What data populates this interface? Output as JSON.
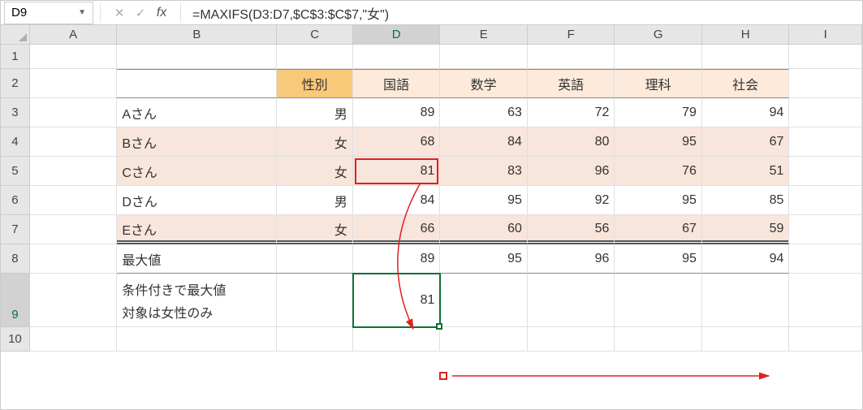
{
  "nameBox": "D9",
  "formula": "=MAXIFS(D3:D7,$C$3:$C$7,\"女\")",
  "fxLabel": "fx",
  "columns": [
    "A",
    "B",
    "C",
    "D",
    "E",
    "F",
    "G",
    "H",
    "I"
  ],
  "rowNumbers": [
    "1",
    "2",
    "3",
    "4",
    "5",
    "6",
    "7",
    "8",
    "9",
    "10"
  ],
  "header": {
    "C": "性別",
    "D": "国語",
    "E": "数学",
    "F": "英語",
    "G": "理科",
    "H": "社会"
  },
  "rows": {
    "r3": {
      "B": "Aさん",
      "C": "男",
      "D": "89",
      "E": "63",
      "F": "72",
      "G": "79",
      "H": "94"
    },
    "r4": {
      "B": "Bさん",
      "C": "女",
      "D": "68",
      "E": "84",
      "F": "80",
      "G": "95",
      "H": "67"
    },
    "r5": {
      "B": "Cさん",
      "C": "女",
      "D": "81",
      "E": "83",
      "F": "96",
      "G": "76",
      "H": "51"
    },
    "r6": {
      "B": "Dさん",
      "C": "男",
      "D": "84",
      "E": "95",
      "F": "92",
      "G": "95",
      "H": "85"
    },
    "r7": {
      "B": "Eさん",
      "C": "女",
      "D": "66",
      "E": "60",
      "F": "56",
      "G": "67",
      "H": "59"
    },
    "r8": {
      "B": "最大値",
      "D": "89",
      "E": "95",
      "F": "96",
      "G": "95",
      "H": "94"
    },
    "r9": {
      "B1": "条件付きで最大値",
      "B2": "対象は女性のみ",
      "D": "81"
    }
  },
  "chart_data": {
    "type": "table",
    "title": "Scores by student and subject; MAXIFS conditional max for 女 (female) students",
    "columns": [
      "性別",
      "国語",
      "数学",
      "英語",
      "理科",
      "社会"
    ],
    "students": [
      {
        "name": "Aさん",
        "性別": "男",
        "国語": 89,
        "数学": 63,
        "英語": 72,
        "理科": 79,
        "社会": 94
      },
      {
        "name": "Bさん",
        "性別": "女",
        "国語": 68,
        "数学": 84,
        "英語": 80,
        "理科": 95,
        "社会": 67
      },
      {
        "name": "Cさん",
        "性別": "女",
        "国語": 81,
        "数学": 83,
        "英語": 96,
        "理科": 76,
        "社会": 51
      },
      {
        "name": "Dさん",
        "性別": "男",
        "国語": 84,
        "数学": 95,
        "英語": 92,
        "理科": 95,
        "社会": 85
      },
      {
        "name": "Eさん",
        "性別": "女",
        "国語": 66,
        "数学": 60,
        "英語": 56,
        "理科": 67,
        "社会": 59
      }
    ],
    "max_all": {
      "国語": 89,
      "数学": 95,
      "英語": 96,
      "理科": 95,
      "社会": 94
    },
    "maxifs_female": {
      "国語": 81
    },
    "formula": "=MAXIFS(D3:D7,$C$3:$C$7,\"女\")",
    "result_cell": "D9",
    "result_value": 81
  }
}
